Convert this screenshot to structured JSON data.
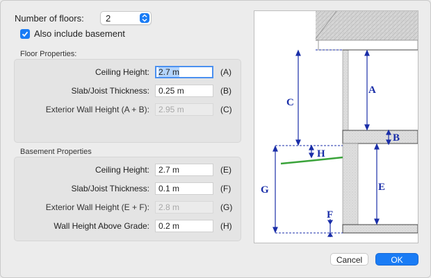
{
  "floors": {
    "label": "Number of floors:",
    "value": "2"
  },
  "basement_checkbox": {
    "label": "Also include basement",
    "checked": true
  },
  "floor_properties": {
    "title": "Floor Properties:",
    "rows": [
      {
        "label": "Ceiling Height:",
        "value": "2.7 m",
        "tag": "(A)",
        "state": "focused"
      },
      {
        "label": "Slab/Joist Thickness:",
        "value": "0.25 m",
        "tag": "(B)",
        "state": "normal"
      },
      {
        "label": "Exterior Wall Height (A + B):",
        "value": "2.95 m",
        "tag": "(C)",
        "state": "disabled"
      }
    ]
  },
  "basement_properties": {
    "title": "Basement Properties",
    "rows": [
      {
        "label": "Ceiling Height:",
        "value": "2.7 m",
        "tag": "(E)",
        "state": "normal"
      },
      {
        "label": "Slab/Joist Thickness:",
        "value": "0.1 m",
        "tag": "(F)",
        "state": "normal"
      },
      {
        "label": "Exterior Wall Height (E + F):",
        "value": "2.8 m",
        "tag": "(G)",
        "state": "disabled"
      },
      {
        "label": "Wall Height Above Grade:",
        "value": "0.2 m",
        "tag": "(H)",
        "state": "normal"
      }
    ]
  },
  "diagram": {
    "labels": {
      "A": "A",
      "B": "B",
      "C": "C",
      "E": "E",
      "F": "F",
      "G": "G",
      "H": "H"
    },
    "colors": {
      "dimension": "#1a2ea8",
      "grade": "#3aa33a",
      "wall": "#dcdcdc"
    }
  },
  "buttons": {
    "cancel": "Cancel",
    "ok": "OK"
  },
  "colors": {
    "accent": "#1a7cf5"
  }
}
